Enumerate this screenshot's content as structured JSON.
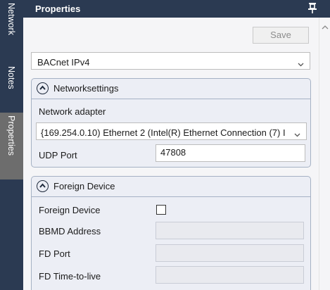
{
  "side_tabs": [
    {
      "label": "Network"
    },
    {
      "label": "Notes"
    },
    {
      "label": "Properties",
      "active": true
    }
  ],
  "header": {
    "title": "Properties"
  },
  "toolbar": {
    "save_label": "Save",
    "save_enabled": false
  },
  "protocol": {
    "selected": "BACnet IPv4"
  },
  "network_settings": {
    "title": "Networksettings",
    "adapter_label": "Network adapter",
    "adapter_selected": "{169.254.0.10) Ethernet 2 (Intel(R) Ethernet Connection (7) I",
    "udp_port_label": "UDP Port",
    "udp_port_value": "47808"
  },
  "foreign_device": {
    "title": "Foreign Device",
    "checkbox_label": "Foreign Device",
    "checkbox_checked": false,
    "bbmd_label": "BBMD Address",
    "bbmd_value": "",
    "fd_port_label": "FD Port",
    "fd_port_value": "",
    "ttl_label": "FD Time-to-live",
    "ttl_value": ""
  },
  "colors": {
    "nav_bg": "#2b3a52",
    "active_tab": "#6d6d6d",
    "group_bg": "#eceef5",
    "group_border": "#a5b1c4"
  },
  "icons": {
    "pin": "pin-icon",
    "collapse": "chevron-up-circle-icon",
    "dropdown": "chevron-down-icon",
    "scroll_up": "scroll-up-arrow-icon"
  }
}
